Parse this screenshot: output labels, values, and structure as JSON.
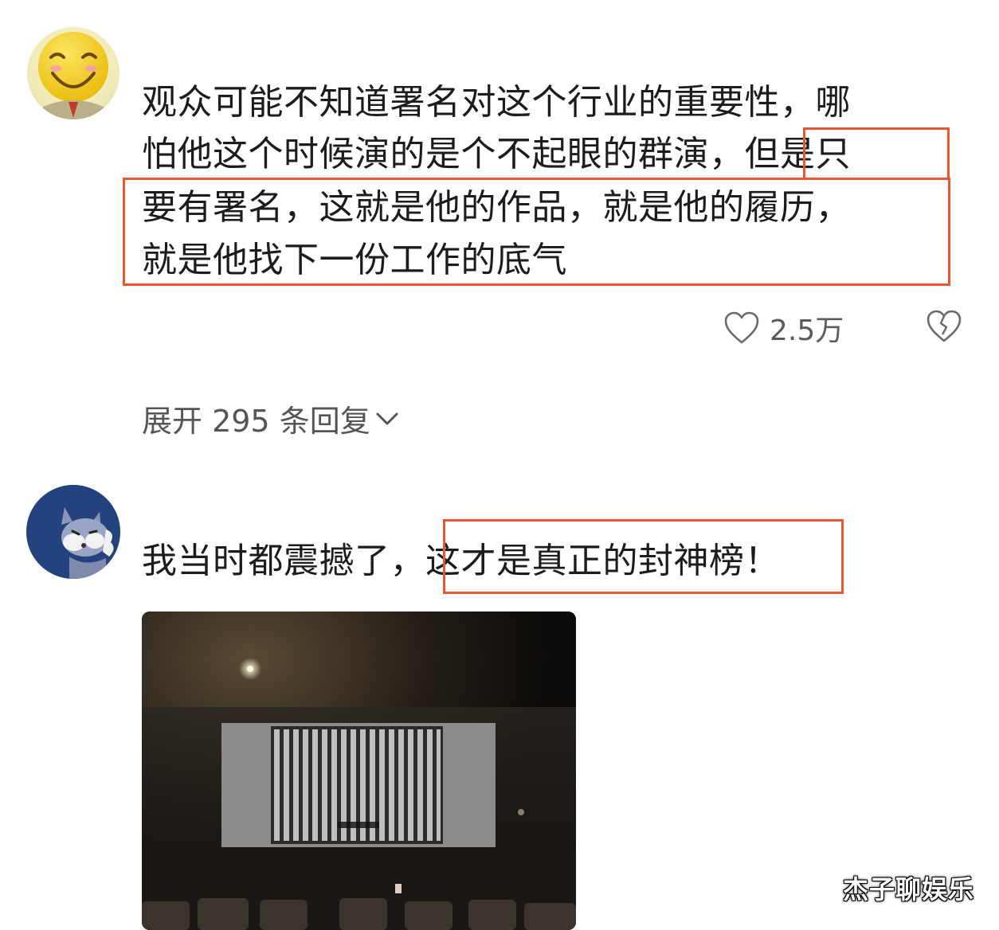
{
  "comment1": {
    "line1": "观众可能不知道署名对这个行业的重要性，哪",
    "line2": "怕他这个时候演的是个不起眼的群演，但是只",
    "line3": "要有署名，这就是他的作品，就是他的履历，",
    "line4": "就是他找下一份工作的底气",
    "like_count": "2.5万",
    "expand_replies": "展开 295 条回复"
  },
  "comment2": {
    "text": "我当时都震撼了，这才是真正的封神榜！"
  },
  "watermark": "杰子聊娱乐",
  "colors": {
    "highlight": "#e8572f",
    "text": "#1c1c1c",
    "muted": "#5c5c5c"
  },
  "icons": [
    "smiley-avatar-icon",
    "cat-avatar-icon",
    "heart-icon",
    "broken-heart-icon",
    "chevron-down-icon"
  ]
}
